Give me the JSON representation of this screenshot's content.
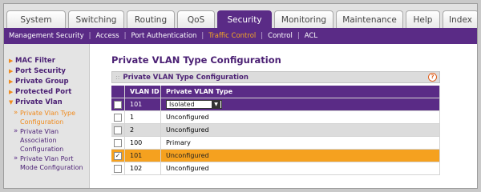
{
  "tabs": [
    {
      "label": "System",
      "active": false
    },
    {
      "label": "Switching",
      "active": false
    },
    {
      "label": "Routing",
      "active": false
    },
    {
      "label": "QoS",
      "active": false
    },
    {
      "label": "Security",
      "active": true
    },
    {
      "label": "Monitoring",
      "active": false
    },
    {
      "label": "Maintenance",
      "active": false
    },
    {
      "label": "Help",
      "active": false
    },
    {
      "label": "Index",
      "active": false
    }
  ],
  "subnav": [
    {
      "label": "Management Security",
      "active": false
    },
    {
      "label": "Access",
      "active": false
    },
    {
      "label": "Port Authentication",
      "active": false
    },
    {
      "label": "Traffic Control",
      "active": true
    },
    {
      "label": "Control",
      "active": false
    },
    {
      "label": "ACL",
      "active": false
    }
  ],
  "sidebar": {
    "items": [
      {
        "label": "MAC Filter",
        "arrow": "▶"
      },
      {
        "label": "Port Security",
        "arrow": "▶"
      },
      {
        "label": "Private Group",
        "arrow": "▶"
      },
      {
        "label": "Protected Port",
        "arrow": "▶"
      },
      {
        "label": "Private Vlan",
        "arrow": "▼"
      }
    ],
    "subitems": [
      {
        "label": "Private Vlan Type Configuration",
        "active": true
      },
      {
        "label": "Private Vlan Association Configuration",
        "active": false
      },
      {
        "label": "Private Vlan Port Mode Configuration",
        "active": false
      }
    ],
    "bullet": "»"
  },
  "page_title": "Private VLAN Type Configuration",
  "panel": {
    "title": "Private VLAN Type Configuration",
    "help": "?",
    "grip": "::"
  },
  "table": {
    "headers": [
      "VLAN ID",
      "Private VLAN Type"
    ],
    "edit_row": {
      "vlan_id": "101",
      "type": "Isolated",
      "dropdown_glyph": "▼"
    },
    "rows": [
      {
        "vlan_id": "1",
        "type": "Unconfigured",
        "checked": false,
        "style": "white"
      },
      {
        "vlan_id": "2",
        "type": "Unconfigured",
        "checked": false,
        "style": "gray"
      },
      {
        "vlan_id": "100",
        "type": "Primary",
        "checked": false,
        "style": "white"
      },
      {
        "vlan_id": "101",
        "type": "Unconfigured",
        "checked": true,
        "style": "sel"
      },
      {
        "vlan_id": "102",
        "type": "Unconfigured",
        "checked": false,
        "style": "white"
      }
    ],
    "check_glyph": "✓"
  },
  "colors": {
    "brand_purple": "#5a2b86",
    "accent_orange": "#f5a11f"
  }
}
